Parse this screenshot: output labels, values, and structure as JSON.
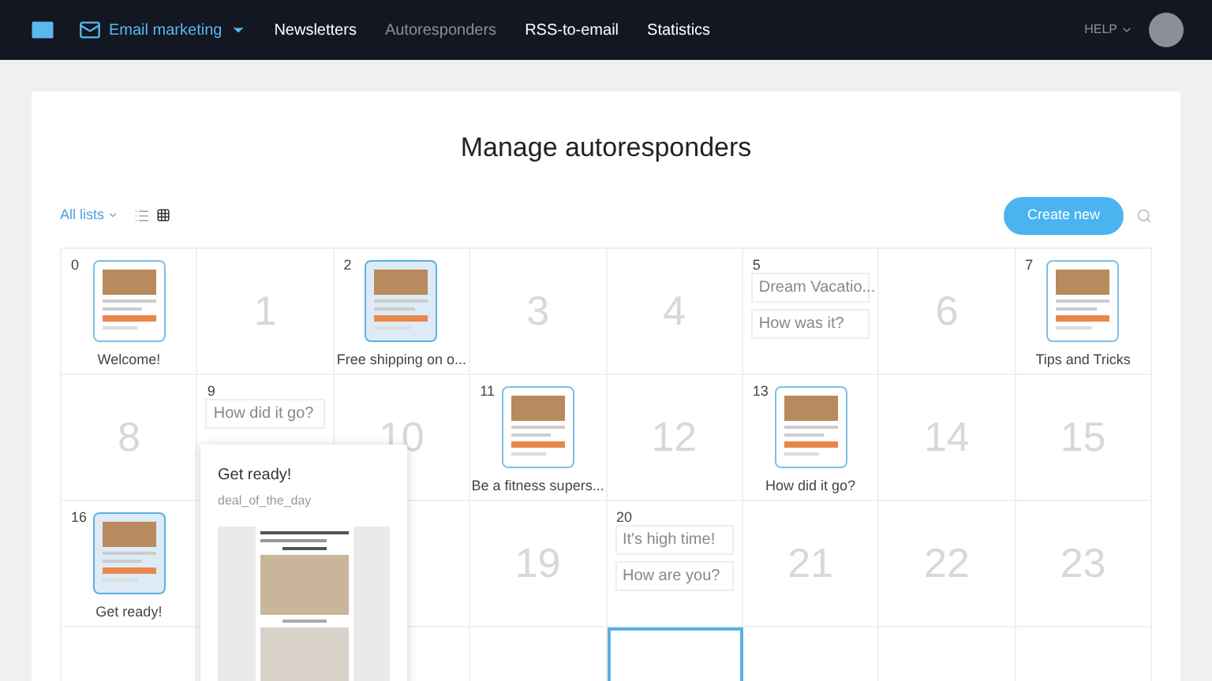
{
  "nav": {
    "items": [
      {
        "label": "Email marketing",
        "selected": false,
        "kind": "menu"
      },
      {
        "label": "Newsletters",
        "selected": false,
        "kind": "link"
      },
      {
        "label": "Autoresponders",
        "selected": true,
        "kind": "link"
      },
      {
        "label": "RSS-to-email",
        "selected": false,
        "kind": "link"
      },
      {
        "label": "Statistics",
        "selected": false,
        "kind": "link"
      }
    ],
    "help": "HELP"
  },
  "title": "Manage autoresponders",
  "toolbar": {
    "filter": "All lists",
    "create": "Create new"
  },
  "grid": {
    "rows": [
      [
        {
          "kind": "email",
          "day": "0",
          "caption": "Welcome!",
          "selected": false
        },
        {
          "kind": "empty",
          "day": "1"
        },
        {
          "kind": "email",
          "day": "2",
          "caption": "Free shipping on o...",
          "selected": true
        },
        {
          "kind": "empty",
          "day": "3"
        },
        {
          "kind": "empty",
          "day": "4"
        },
        {
          "kind": "subjects",
          "day": "5",
          "subjects": [
            "Dream Vacatio...",
            "How was it?"
          ]
        },
        {
          "kind": "empty",
          "day": "6"
        },
        {
          "kind": "email",
          "day": "7",
          "caption": "Tips and Tricks",
          "selected": false
        }
      ],
      [
        {
          "kind": "empty",
          "day": "8"
        },
        {
          "kind": "subjects",
          "day": "9",
          "subjects": [
            "How did it go?"
          ]
        },
        {
          "kind": "empty",
          "day": "10"
        },
        {
          "kind": "email",
          "day": "11",
          "caption": "Be a fitness supers...",
          "selected": false
        },
        {
          "kind": "empty",
          "day": "12"
        },
        {
          "kind": "email",
          "day": "13",
          "caption": "How did it go?",
          "selected": false
        },
        {
          "kind": "empty",
          "day": "14"
        },
        {
          "kind": "empty",
          "day": "15"
        }
      ],
      [
        {
          "kind": "email",
          "day": "16",
          "caption": "Get ready!",
          "selected": true
        },
        {
          "kind": "blank"
        },
        {
          "kind": "blank"
        },
        {
          "kind": "empty",
          "day": "19"
        },
        {
          "kind": "subjects",
          "day": "20",
          "subjects": [
            "It's high time!",
            "How are you?"
          ]
        },
        {
          "kind": "empty",
          "day": "21"
        },
        {
          "kind": "empty",
          "day": "22"
        },
        {
          "kind": "empty",
          "day": "23"
        }
      ],
      [
        {
          "kind": "blank"
        },
        {
          "kind": "blank"
        },
        {
          "kind": "blank"
        },
        {
          "kind": "blank"
        },
        {
          "kind": "blank",
          "selected": true
        },
        {
          "kind": "blank"
        },
        {
          "kind": "blank"
        },
        {
          "kind": "blank"
        }
      ]
    ]
  },
  "popup": {
    "title": "Get ready!",
    "template": "deal_of_the_day"
  }
}
